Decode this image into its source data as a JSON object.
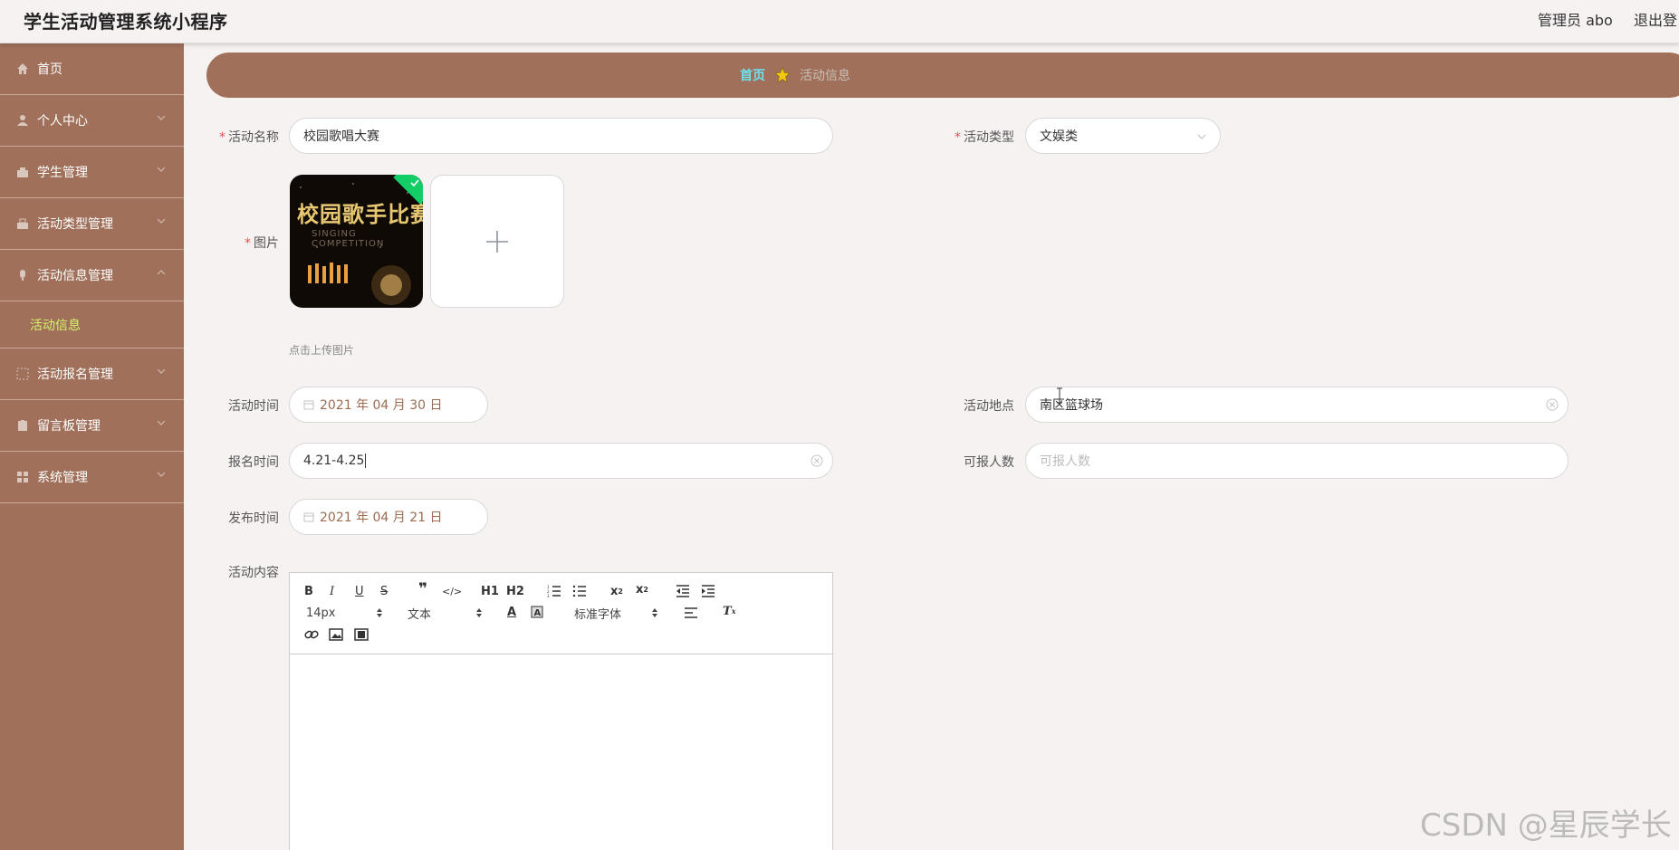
{
  "app": {
    "title": "学生活动管理系统小程序",
    "user": "管理员 abo",
    "logout": "退出登"
  },
  "sidebar": {
    "items": [
      {
        "label": "首页",
        "icon": "home-icon"
      },
      {
        "label": "个人中心",
        "icon": "user-icon"
      },
      {
        "label": "学生管理",
        "icon": "student-icon"
      },
      {
        "label": "活动类型管理",
        "icon": "category-icon"
      },
      {
        "label": "活动信息管理",
        "icon": "info-icon"
      },
      {
        "label": "活动报名管理",
        "icon": "signup-icon"
      },
      {
        "label": "留言板管理",
        "icon": "message-icon"
      },
      {
        "label": "系统管理",
        "icon": "settings-icon"
      }
    ],
    "submenu": {
      "label": "活动信息"
    }
  },
  "breadcrumb": {
    "home": "首页",
    "current": "活动信息"
  },
  "form": {
    "name": {
      "label": "活动名称",
      "value": "校园歌唱大赛"
    },
    "type": {
      "label": "活动类型",
      "value": "文娱类"
    },
    "image": {
      "label": "图片",
      "hint": "点击上传图片",
      "thumb_title": "校园歌手比赛",
      "thumb_subtitle": "SINGING COMPETITION"
    },
    "time": {
      "label": "活动时间",
      "value": "2021 年 04 月 30 日"
    },
    "location": {
      "label": "活动地点",
      "value": "南区篮球场"
    },
    "signup_time": {
      "label": "报名时间",
      "value": "4.21-4.25"
    },
    "capacity": {
      "label": "可报人数",
      "placeholder": "可报人数"
    },
    "publish_time": {
      "label": "发布时间",
      "value": "2021 年 04 月 21 日"
    },
    "content": {
      "label": "活动内容"
    }
  },
  "editor": {
    "font_size": "14px",
    "block_type": "文本",
    "font_family": "标准字体",
    "h1": "H1",
    "h2": "H2"
  },
  "watermark": "CSDN @星辰学长",
  "colors": {
    "sidebar": "#a0705a",
    "accent_submenu": "#d4f56a",
    "breadcrumb_home": "#6fe0f0",
    "required": "#e35050",
    "success": "#13ce66"
  }
}
